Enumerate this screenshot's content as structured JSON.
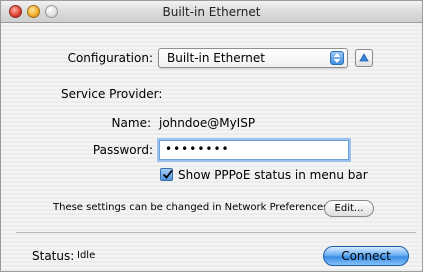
{
  "window": {
    "title": "Built-in Ethernet"
  },
  "form": {
    "configuration_label": "Configuration:",
    "configuration_value": "Built-in Ethernet",
    "service_provider_label": "Service Provider:",
    "name_label": "Name:",
    "name_value": "johndoe@MyISP",
    "password_label": "Password:",
    "password_masked": "••••••••",
    "show_status_label": "Show PPPoE status in menu bar",
    "show_status_checked": true
  },
  "notice": {
    "text": "These settings can be changed in Network Preferences.",
    "edit_button": "Edit..."
  },
  "footer": {
    "status_label": "Status:",
    "status_value": "Idle",
    "connect_button": "Connect"
  }
}
